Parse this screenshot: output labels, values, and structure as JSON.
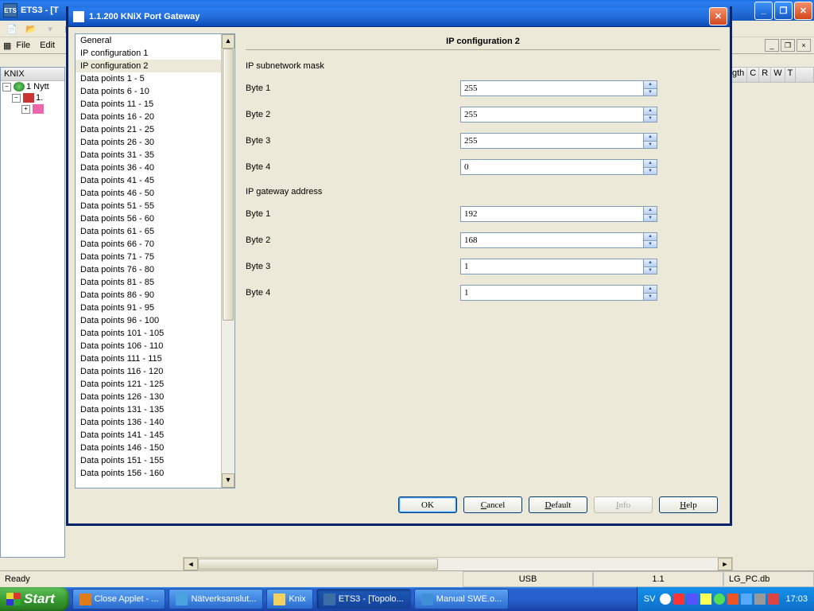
{
  "parent_window": {
    "title": "ETS3 - [T",
    "menubar": {
      "file": "File",
      "edit": "Edit"
    },
    "tree": {
      "root": "KNIX",
      "node1": "1 Nytt",
      "node2": "1."
    },
    "right_columns": [
      "gth",
      "C",
      "R",
      "W",
      "T"
    ]
  },
  "dialog": {
    "title": "1.1.200 KNiX Port Gateway",
    "sidebar_items": [
      "General",
      "IP configuration 1",
      "IP configuration 2",
      "Data points 1 - 5",
      "Data points 6 - 10",
      "Data points 11 - 15",
      "Data points 16 - 20",
      "Data points 21 - 25",
      "Data points 26 - 30",
      "Data points 31 - 35",
      "Data points 36 - 40",
      "Data points 41 - 45",
      "Data points 46 - 50",
      "Data points 51 - 55",
      "Data points 56 - 60",
      "Data points 61 - 65",
      "Data points 66 - 70",
      "Data points 71 - 75",
      "Data points 76 - 80",
      "Data points 81 - 85",
      "Data points 86 - 90",
      "Data points 91 - 95",
      "Data points 96 - 100",
      "Data points 101 - 105",
      "Data points 106 - 110",
      "Data points 111 - 115",
      "Data points 116 - 120",
      "Data points 121 - 125",
      "Data points 126 - 130",
      "Data points 131 - 135",
      "Data points 136 - 140",
      "Data points 141 - 145",
      "Data points 146 - 150",
      "Data points 151 - 155",
      "Data points 156 - 160"
    ],
    "sidebar_selected_index": 2,
    "panel": {
      "title": "IP configuration 2",
      "section1_label": "IP subnetwork mask",
      "section2_label": "IP gateway address",
      "byte_label_1": "Byte 1",
      "byte_label_2": "Byte 2",
      "byte_label_3": "Byte 3",
      "byte_label_4": "Byte 4",
      "subnet": {
        "b1": "255",
        "b2": "255",
        "b3": "255",
        "b4": "0"
      },
      "gateway": {
        "b1": "192",
        "b2": "168",
        "b3": "1",
        "b4": "1"
      }
    },
    "buttons": {
      "ok": "OK",
      "cancel": "Cancel",
      "default": "Default",
      "info": "Info",
      "help": "Help"
    }
  },
  "statusbar": {
    "ready": "Ready",
    "usb": "USB",
    "addr": "1.1",
    "db": "LG_PC.db"
  },
  "taskbar": {
    "start": "Start",
    "items": [
      {
        "label": "Close Applet - ..."
      },
      {
        "label": "Nätverksanslut..."
      },
      {
        "label": "Knix"
      },
      {
        "label": "ETS3 - [Topolo..."
      },
      {
        "label": "Manual SWE.o..."
      }
    ],
    "active_index": 3,
    "lang": "SV",
    "clock": "17:03"
  }
}
